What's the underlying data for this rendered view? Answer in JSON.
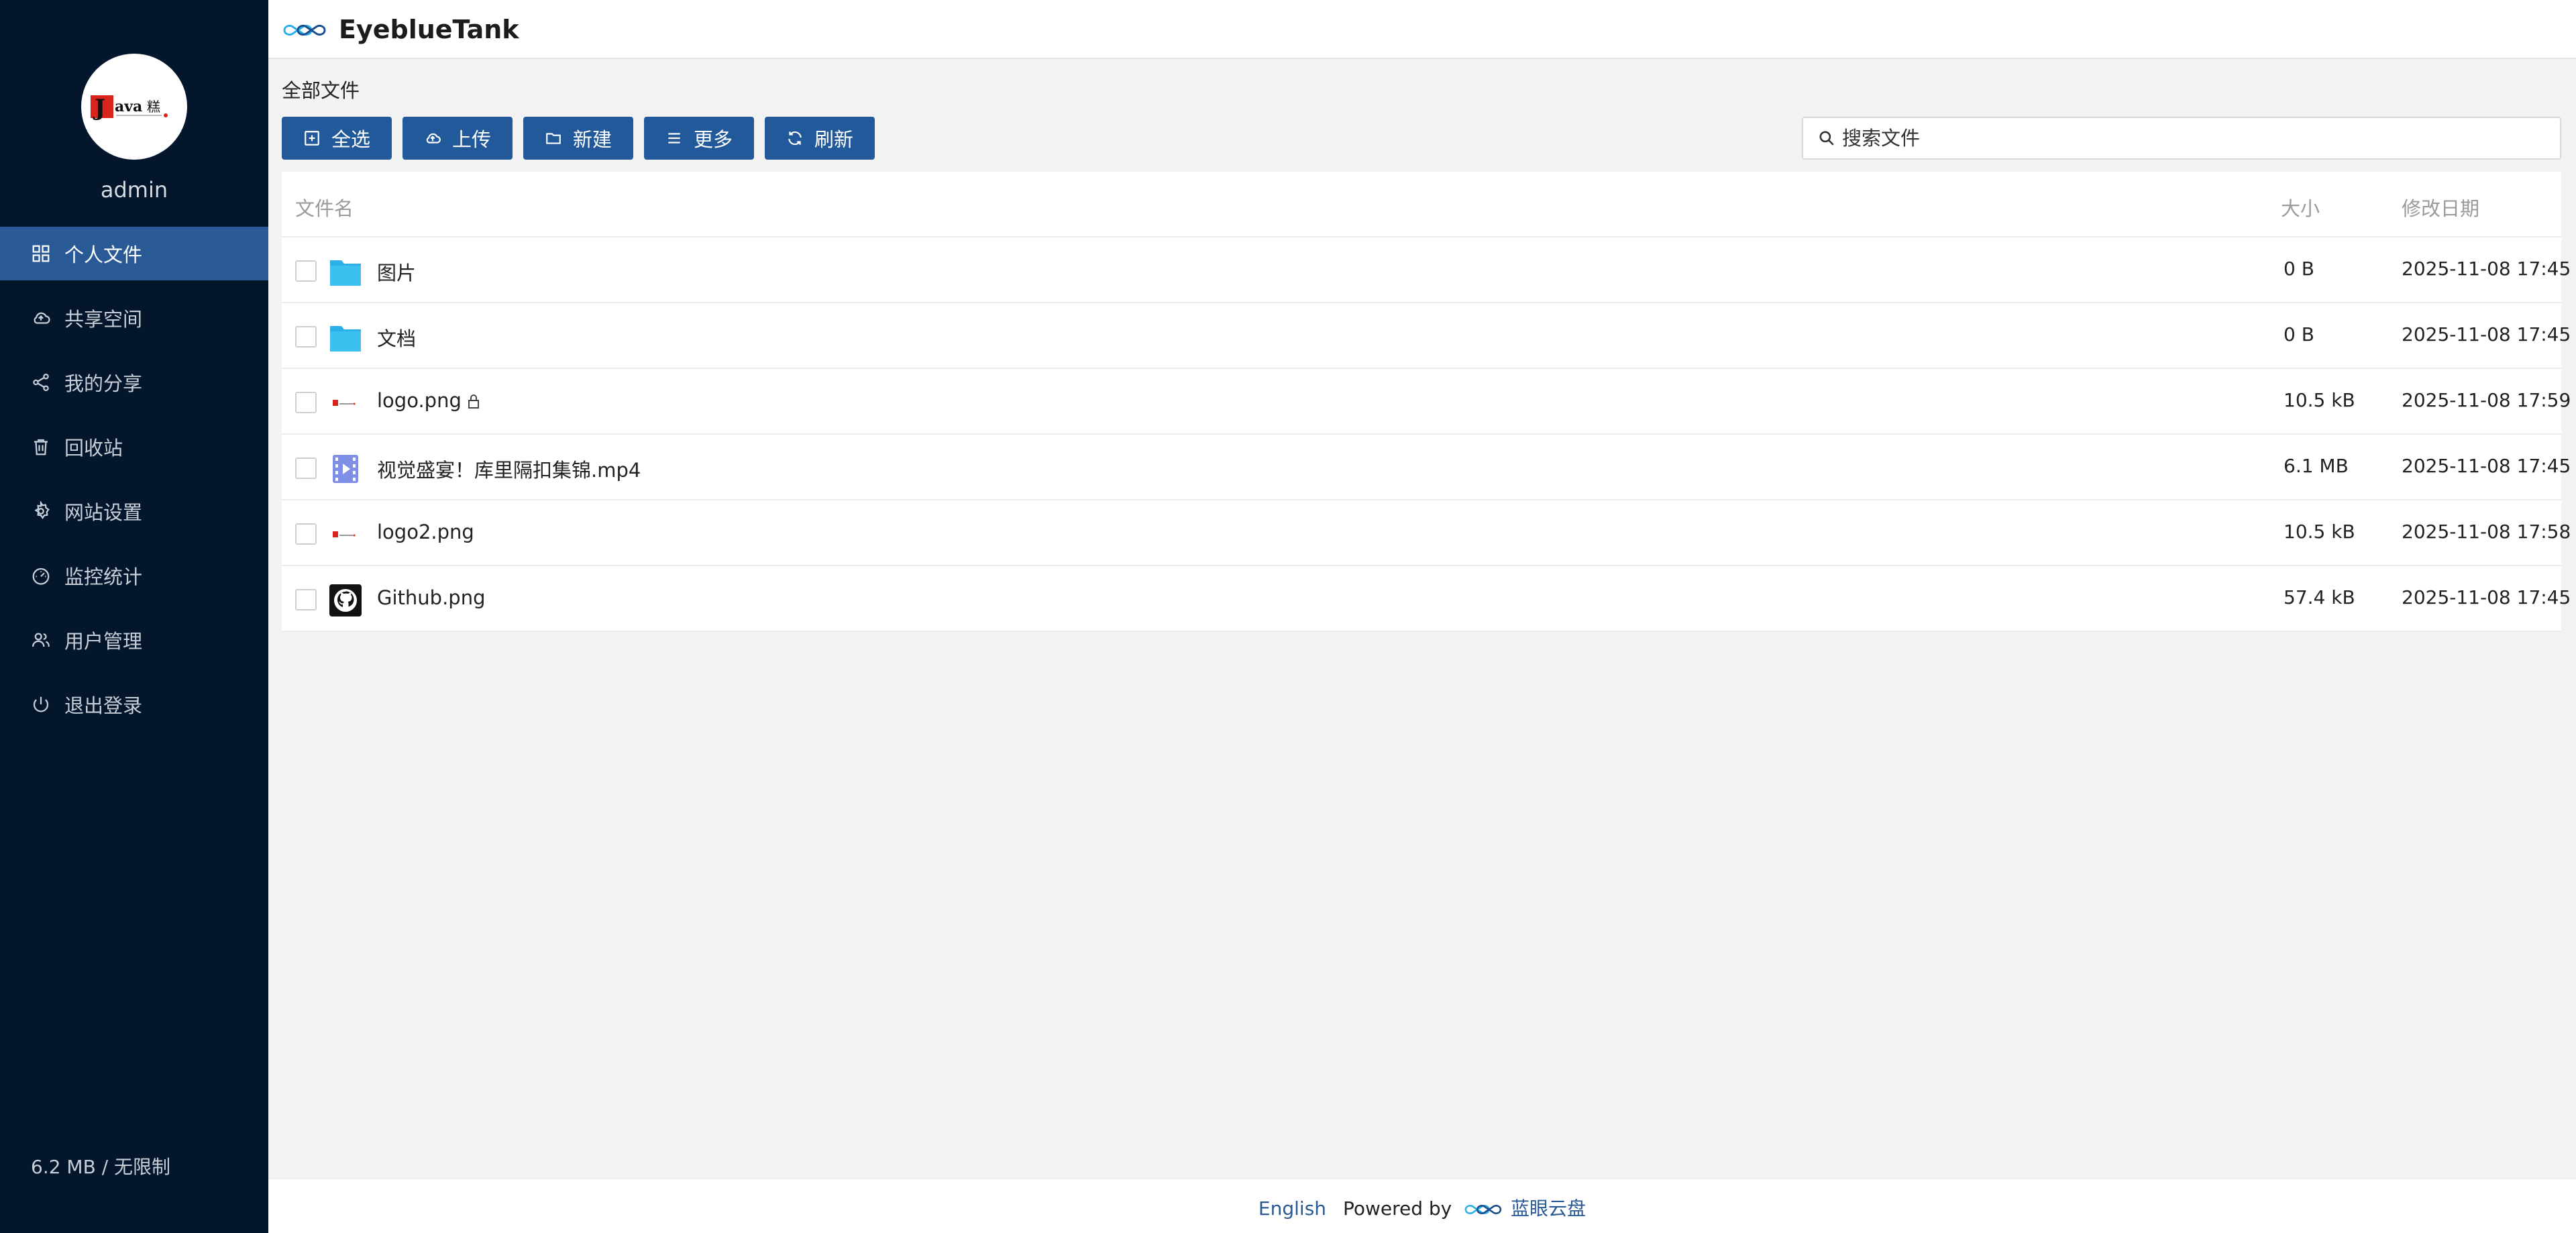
{
  "sidebar": {
    "avatar_text": "Java",
    "username": "admin",
    "items": [
      {
        "label": "个人文件",
        "icon": "grid-icon",
        "active": true
      },
      {
        "label": "共享空间",
        "icon": "cloud-icon"
      },
      {
        "label": "我的分享",
        "icon": "share-icon"
      },
      {
        "label": "回收站",
        "icon": "trash-icon"
      },
      {
        "label": "网站设置",
        "icon": "gear-icon"
      },
      {
        "label": "监控统计",
        "icon": "dashboard-icon"
      },
      {
        "label": "用户管理",
        "icon": "users-icon"
      },
      {
        "label": "退出登录",
        "icon": "power-icon"
      }
    ],
    "quota": "6.2 MB / 无限制"
  },
  "header": {
    "brand": "EyeblueTank"
  },
  "main": {
    "breadcrumb": "全部文件",
    "toolbar": {
      "select_all": "全选",
      "upload": "上传",
      "new": "新建",
      "more": "更多",
      "refresh": "刷新"
    },
    "search": {
      "placeholder": "搜索文件"
    },
    "table": {
      "headers": {
        "name": "文件名",
        "size": "大小",
        "date": "修改日期"
      },
      "rows": [
        {
          "name": "图片",
          "type": "folder-icon",
          "size": "0 B",
          "date": "2025-11-08 17:45"
        },
        {
          "name": "文档",
          "type": "folder-icon",
          "size": "0 B",
          "date": "2025-11-08 17:45"
        },
        {
          "name": "logo.png",
          "type": "image-thumbnail-icon",
          "locked": true,
          "size": "10.5 kB",
          "date": "2025-11-08 17:59"
        },
        {
          "name": "视觉盛宴！库里隔扣集锦.mp4",
          "type": "video-file-icon",
          "size": "6.1 MB",
          "date": "2025-11-08 17:45"
        },
        {
          "name": "logo2.png",
          "type": "image-thumbnail-icon",
          "size": "10.5 kB",
          "date": "2025-11-08 17:58"
        },
        {
          "name": "Github.png",
          "type": "github-icon",
          "size": "57.4 kB",
          "date": "2025-11-08 17:45"
        }
      ]
    }
  },
  "footer": {
    "language": "English",
    "powered_by": "Powered by",
    "brand": "蓝眼云盘"
  },
  "colors": {
    "sidebar_bg": "#04162c",
    "accent": "#2a5a95",
    "button": "#22599a",
    "folder": "#2bb0e8"
  }
}
